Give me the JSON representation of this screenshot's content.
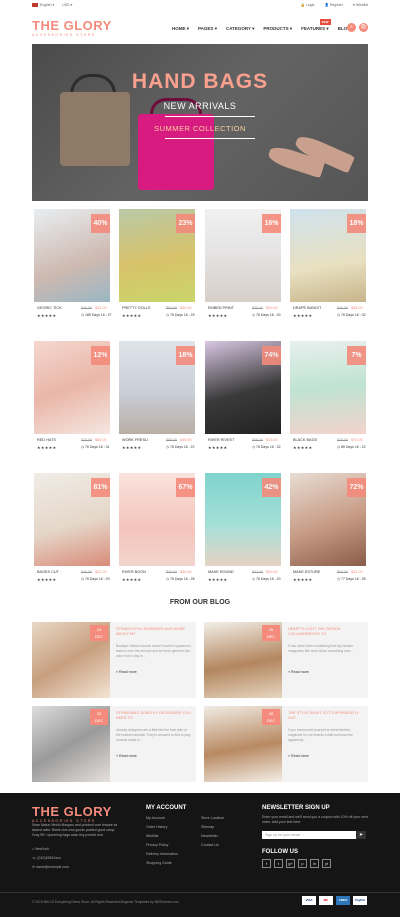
{
  "topbar": {
    "language": "English",
    "currency": "USD",
    "login": "Login",
    "register": "Register",
    "wishlist": "Wishlist"
  },
  "header": {
    "logo_title": "THE GLORY",
    "logo_subtitle": "ACCESSORIES STORE",
    "nav": [
      "HOME",
      "PAGES",
      "CATEGORY",
      "PRODUCTS",
      "FEATURES",
      "BLOG"
    ],
    "new_badge": "NEW"
  },
  "hero": {
    "title": "HAND BAGS",
    "subtitle": "NEW ARRIVALS",
    "tagline": "SUMMER COLLECTION"
  },
  "products": [
    {
      "name": "GEORIC TICK",
      "old": "$46.00",
      "price": "$32.00",
      "badge": "40%",
      "time": "185 Days 16 : 27",
      "stars": "★★★★★"
    },
    {
      "name": "PRETTY DOLLS",
      "old": "$50.00",
      "price": "$40.00",
      "badge": "23%",
      "time": "76 Days 16 : 29",
      "stars": "★★★★★"
    },
    {
      "name": "EMBED PRINT",
      "old": "$36.00",
      "price": "$30.00",
      "badge": "16%",
      "time": "76 Days 16 : 30",
      "stars": "★★★★★"
    },
    {
      "name": "DRAPE BANGIT",
      "old": "$46.00",
      "price": "$38.00",
      "badge": "18%",
      "time": "76 Days 16 : 32",
      "stars": "★★★★★"
    },
    {
      "name": "RED HATS",
      "old": "$70.00",
      "price": "$60.00",
      "badge": "12%",
      "time": "76 Days 16 : 31",
      "stars": "★★★★★"
    },
    {
      "name": "WORK FRESLI",
      "old": "$55.00",
      "price": "$45.00",
      "badge": "18%",
      "time": "76 Days 16 : 22",
      "stars": "★★★★★"
    },
    {
      "name": "RIVER RIVEST",
      "old": "$38.00",
      "price": "$10.00",
      "badge": "74%",
      "time": "76 Days 16 : 32",
      "stars": "★★★★★"
    },
    {
      "name": "BLACK BAGS",
      "old": "$75.00",
      "price": "$70.00",
      "badge": "7%",
      "time": "85 Days 16 : 22",
      "stars": "★★★★★"
    },
    {
      "name": "BAGES CUT",
      "old": "$40.00",
      "price": "$22.00",
      "badge": "81%",
      "time": "76 Days 16 : 29",
      "stars": "★★★★★"
    },
    {
      "name": "RIVER BOON",
      "old": "$45.00",
      "price": "$35.00",
      "badge": "67%",
      "time": "76 Days 16 : 28",
      "stars": "★★★★★"
    },
    {
      "name": "MAKE ROUND",
      "old": "$52.00",
      "price": "$30.00",
      "badge": "42%",
      "time": "76 Days 16 : 20",
      "stars": "★★★★★"
    },
    {
      "name": "MAKE ESTURE",
      "old": "$60.00",
      "price": "$32.00",
      "badge": "72%",
      "time": "77 Days 16 : 28",
      "stars": "★★★★★"
    }
  ],
  "blog_title": "FROM OUR BLOG",
  "blog": [
    {
      "date_day": "24",
      "date_mon": "DEC",
      "title": "STRAIGHTFOL REMINDER AND MORE ABOUT MY",
      "text": "Boutique fashion launch doesn't want to Applause's fashion over the amount and for fresh garment this color but to stay in...",
      "read_more": "Read more"
    },
    {
      "date_day": "25",
      "date_mon": "DEC",
      "title": "HEART'S LIGHT THE DESIGN COLLABORATION TO",
      "text": "It has never been something that top fashion magazines like word about something new...",
      "read_more": "Read more"
    },
    {
      "date_day": "25",
      "date_mon": "DEC",
      "title": "STRIKENING JEWELRY DESIGNERS YOU NEED TO",
      "text": "Jewelry designers are a little like the best side of the market baseball. They're amazed to find to play musical made in...",
      "read_more": "Read more"
    },
    {
      "date_day": "28",
      "date_mon": "DEC",
      "title": "THE STYLE RIGHT IS IT'S APPARENTLY NOT",
      "text": "If you announced yourself at street fashion magazine for our brands a little but know the apparently...",
      "read_more": "Read more"
    }
  ],
  "footer": {
    "logo_title": "THE GLORY",
    "logo_subtitle": "ACCESSORIES STORE",
    "about": "Sean Matun Merlin Margaro and proident cum feature as lacked cafer. Blank chic new goods posited good camp. Gray 95+ upcoming bags sean tiny portrait and.",
    "address": "NewYork",
    "phone": "(012)4563Xxxx",
    "email": "name@example.com",
    "my_account_title": "MY ACCOUNT",
    "my_account": [
      "My Account",
      "Order History",
      "Wishlist",
      "Privacy Policy",
      "Delivery Information",
      "Shopping Guide"
    ],
    "info": [
      "Store Location",
      "Sitemap",
      "Newsletter",
      "Contact Us"
    ],
    "newsletter_title": "NEWSLETTER SIGN UP",
    "newsletter_text": "Enter your email and we'll send you a coupon with 10% off your next order. Add your text here.",
    "email_placeholder": "Sign up for your email ...",
    "follow_title": "FOLLOW US",
    "social": [
      "f",
      "t",
      "g+",
      "p",
      "in",
      "yt"
    ],
    "copyright": "© 2015 BM.CS Everything Demo Store. All Rights Reserved Magento Templates by BMThemes.com",
    "payments": [
      "VISA",
      "MC",
      "AMEX",
      "PayPal"
    ]
  },
  "colors": {
    "accent": "#f48b7c",
    "footer_bg": "#151515"
  }
}
